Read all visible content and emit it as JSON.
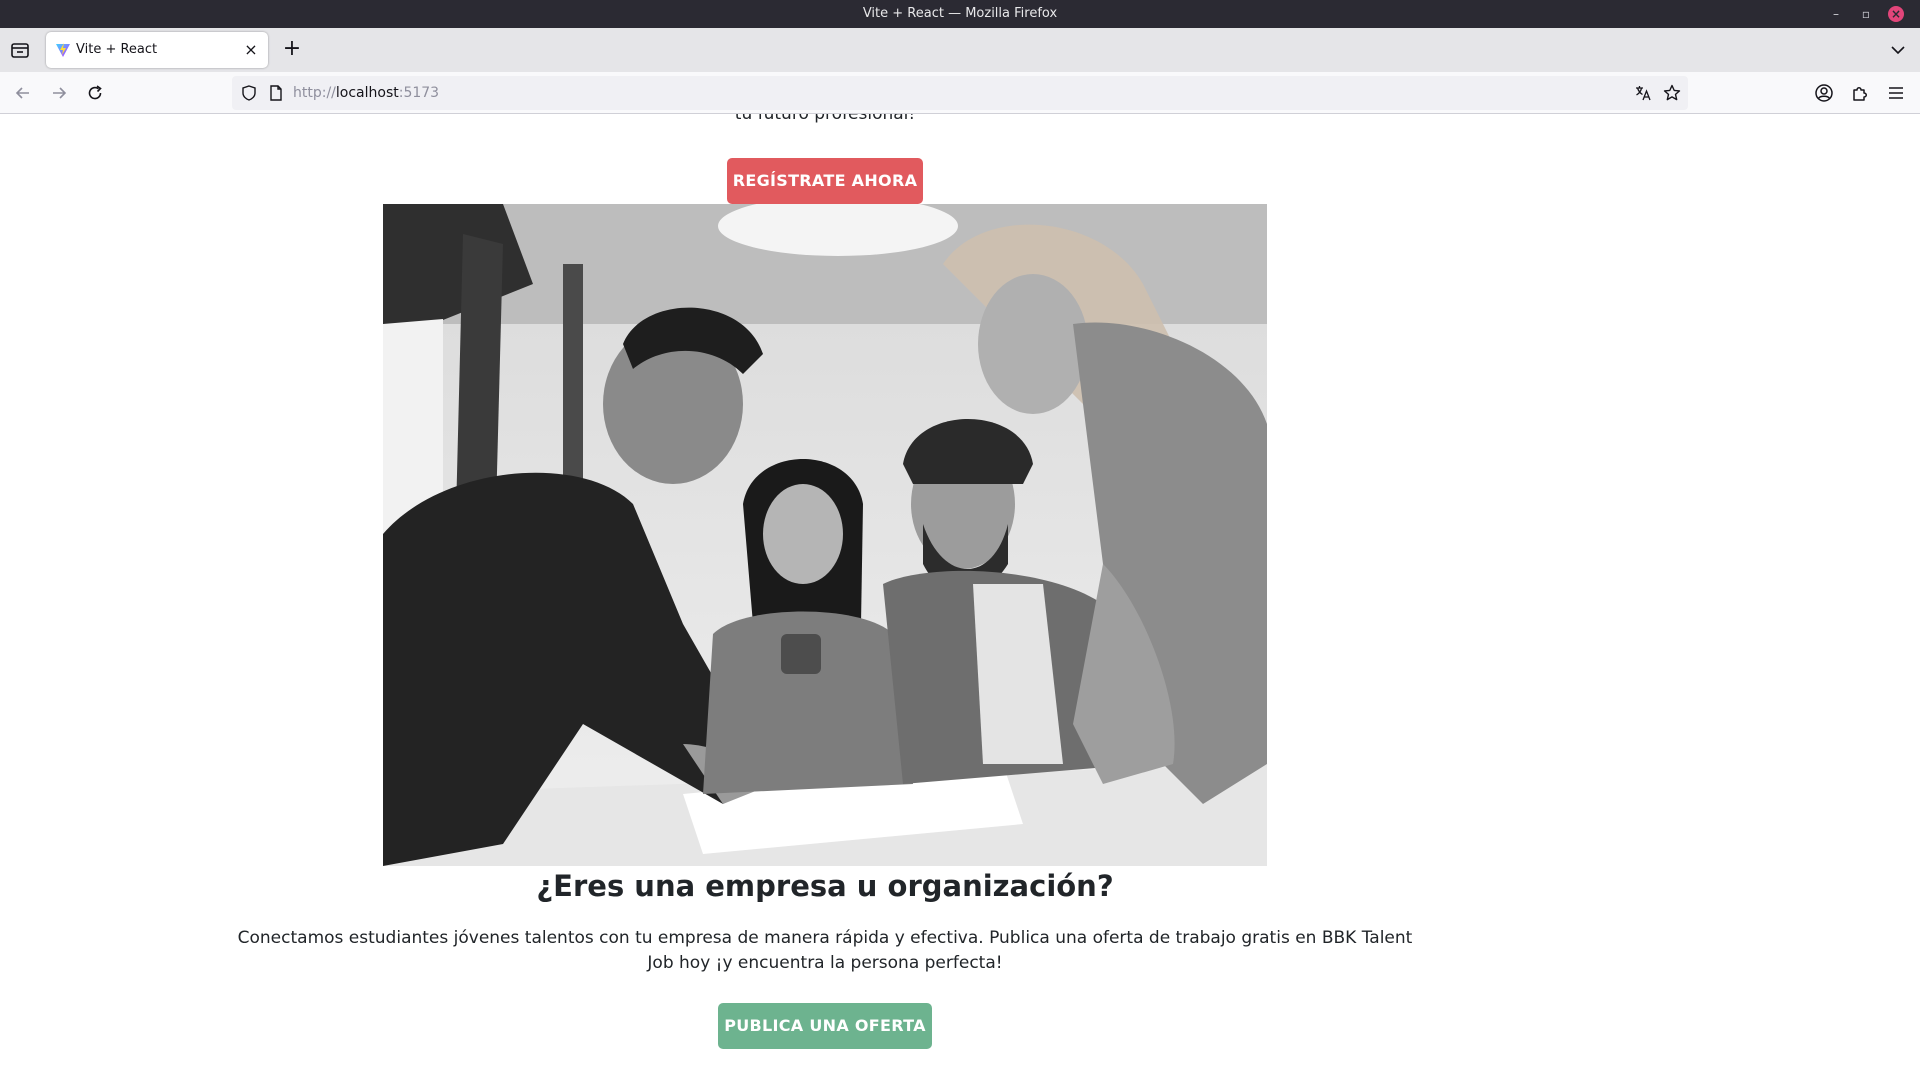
{
  "window": {
    "title": "Vite + React — Mozilla Firefox"
  },
  "tabs": [
    {
      "label": "Vite + React",
      "active": true,
      "favicon": "vite-logo-icon"
    }
  ],
  "navbar": {
    "url_scheme": "http://",
    "url_host": "localhost",
    "url_port": ":5173"
  },
  "page": {
    "hero_text_partial": "tu futuro profesional!",
    "register_button": "REGÍSTRATE AHORA",
    "photo": {
      "description_icon": "team-photo",
      "style": "grayscale"
    },
    "company_heading": "¿Eres una empresa u organización?",
    "company_description": "Conectamos estudiantes jóvenes talentos con tu empresa de manera rápida y efectiva. Publica una oferta de trabajo gratis en BBK Talent Job hoy ¡y encuentra la persona perfecta!",
    "publish_button": "PUBLICA UNA OFERTA"
  },
  "colors": {
    "register_button_bg": "#e15a5e",
    "publish_button_bg": "#6db38f",
    "titlebar_bg": "#2b2a33"
  }
}
